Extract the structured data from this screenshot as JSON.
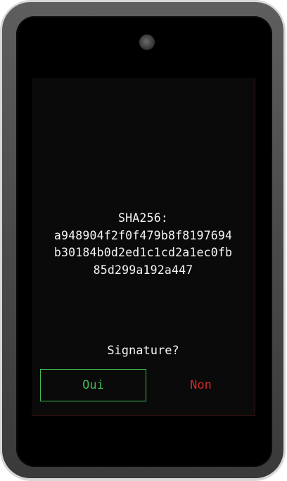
{
  "screen": {
    "hash_label": "SHA256:",
    "hash_lines": [
      "a948904f2f0f479b8f8197694",
      "b30184b0d2ed1c1cd2a1ec0fb",
      "85d299a192a447"
    ],
    "prompt": "Signature?",
    "confirm_label": "Oui",
    "cancel_label": "Non"
  },
  "colors": {
    "device_body": "#4a4a4a",
    "screen_background": "#000000",
    "text": "#f4f4f4",
    "confirm": "#3dbb52",
    "cancel": "#d02828"
  }
}
